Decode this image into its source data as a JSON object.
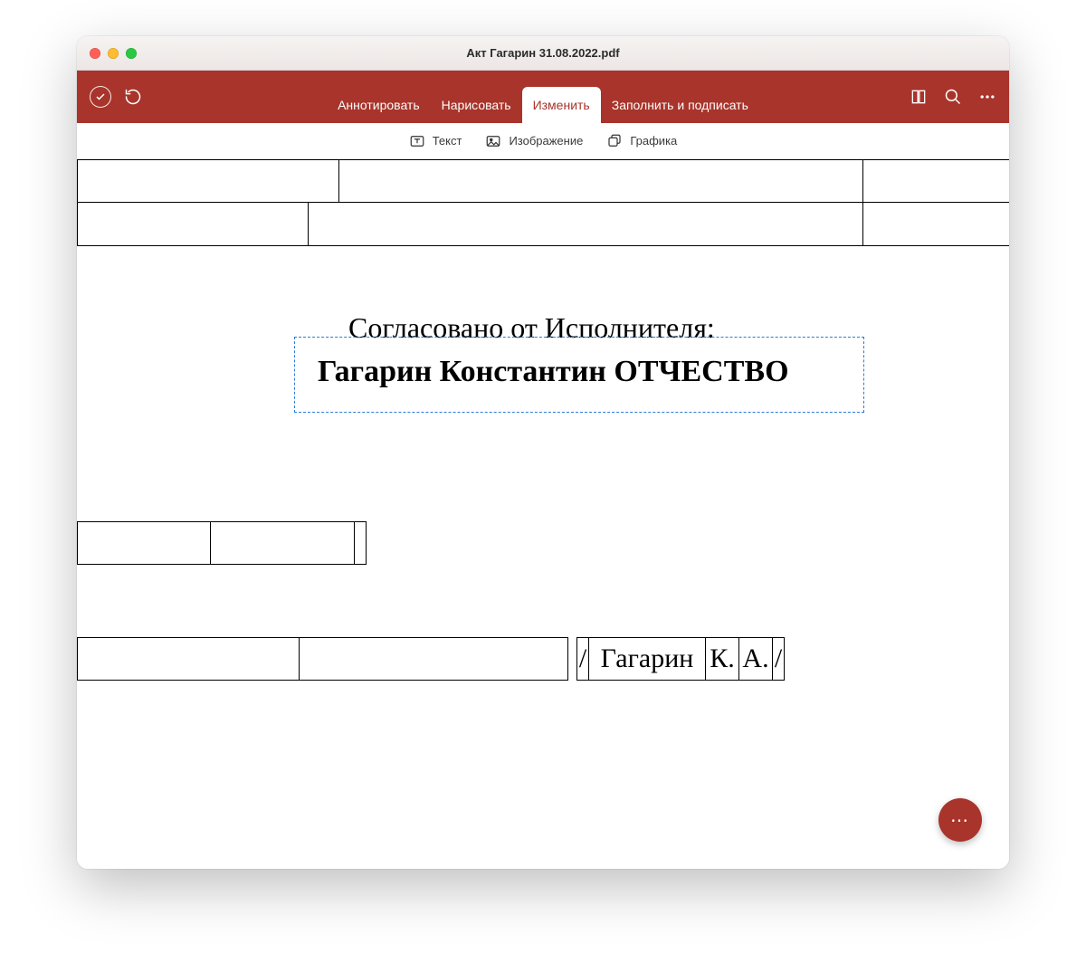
{
  "window": {
    "title": "Акт Гагарин 31.08.2022.pdf"
  },
  "tabs": {
    "annotate": "Аннотировать",
    "draw": "Нарисовать",
    "edit": "Изменить",
    "fill_sign": "Заполнить и подписать"
  },
  "subtoolbar": {
    "text": "Текст",
    "image": "Изображение",
    "graphic": "Графика"
  },
  "document": {
    "approved_label": "Согласовано от Исполнителя:",
    "full_name": "Гагарин Константин ОТЧЕСТВО",
    "signature": {
      "slash1": "/",
      "surname": "Гагарин",
      "initial_k": "К.",
      "initial_a": "А.",
      "slash2": "/"
    }
  },
  "fab": {
    "label": "⋯"
  }
}
